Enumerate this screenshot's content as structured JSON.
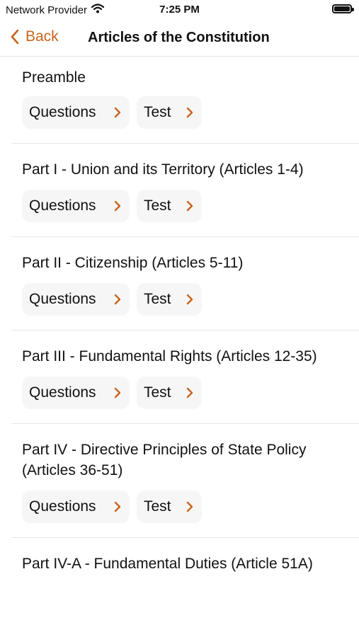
{
  "status": {
    "carrier": "Network Provider",
    "time": "7:25 PM"
  },
  "nav": {
    "back_label": "Back",
    "title": "Articles of the Constitution"
  },
  "buttons": {
    "questions_label": "Questions",
    "test_label": "Test"
  },
  "sections": [
    {
      "title": "Preamble"
    },
    {
      "title": "Part I - Union and its Territory (Articles 1-4)"
    },
    {
      "title": "Part II - Citizenship (Articles 5-11)"
    },
    {
      "title": "Part III - Fundamental Rights (Articles 12-35)"
    },
    {
      "title": "Part IV - Directive Principles of State Policy (Articles 36-51)"
    },
    {
      "title": "Part IV-A - Fundamental Duties (Article 51A)"
    }
  ],
  "colors": {
    "accent": "#c8641c",
    "pill_bg": "#f6f6f6"
  }
}
